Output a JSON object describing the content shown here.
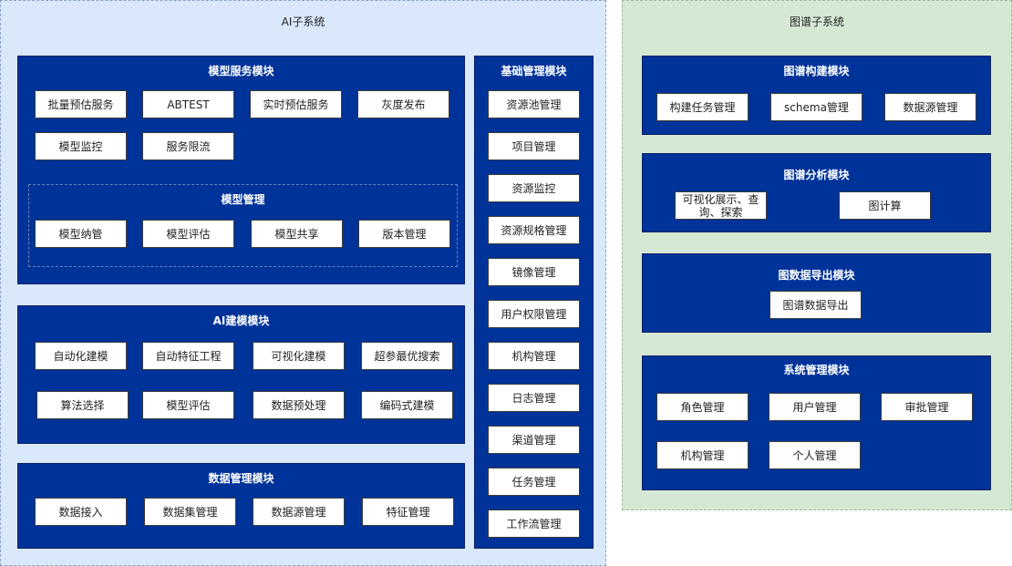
{
  "ai_system": {
    "title": "AI子系统",
    "model_service": {
      "title": "模型服务模块",
      "items": [
        "批量预估服务",
        "ABTEST",
        "实时预估服务",
        "灰度发布",
        "模型监控",
        "服务限流"
      ],
      "model_management": {
        "title": "模型管理",
        "items": [
          "模型纳管",
          "模型评估",
          "模型共享",
          "版本管理"
        ]
      }
    },
    "ai_modeling": {
      "title": "AI建模模块",
      "items": [
        "自动化建模",
        "自动特征工程",
        "可视化建模",
        "超参最优搜索",
        "算法选择",
        "模型评估",
        "数据预处理",
        "编码式建模"
      ]
    },
    "data_management": {
      "title": "数据管理模块",
      "items": [
        "数据接入",
        "数据集管理",
        "数据源管理",
        "特征管理"
      ]
    },
    "basic_management": {
      "title": "基础管理模块",
      "items": [
        "资源池管理",
        "项目管理",
        "资源监控",
        "资源规格管理",
        "镜像管理",
        "用户权限管理",
        "机构管理",
        "日志管理",
        "渠道管理",
        "任务管理",
        "工作流管理"
      ]
    }
  },
  "graph_system": {
    "title": "图谱子系统",
    "graph_build": {
      "title": "图谱构建模块",
      "items": [
        "构建任务管理",
        "schema管理",
        "数据源管理"
      ]
    },
    "graph_analysis": {
      "title": "图谱分析模块",
      "items": [
        "可视化展示、查询、探索",
        "图计算"
      ]
    },
    "graph_export": {
      "title": "图数据导出模块",
      "items": [
        "图谱数据导出"
      ]
    },
    "system_management": {
      "title": "系统管理模块",
      "items": [
        "角色管理",
        "用户管理",
        "审批管理",
        "机构管理",
        "个人管理"
      ]
    }
  }
}
